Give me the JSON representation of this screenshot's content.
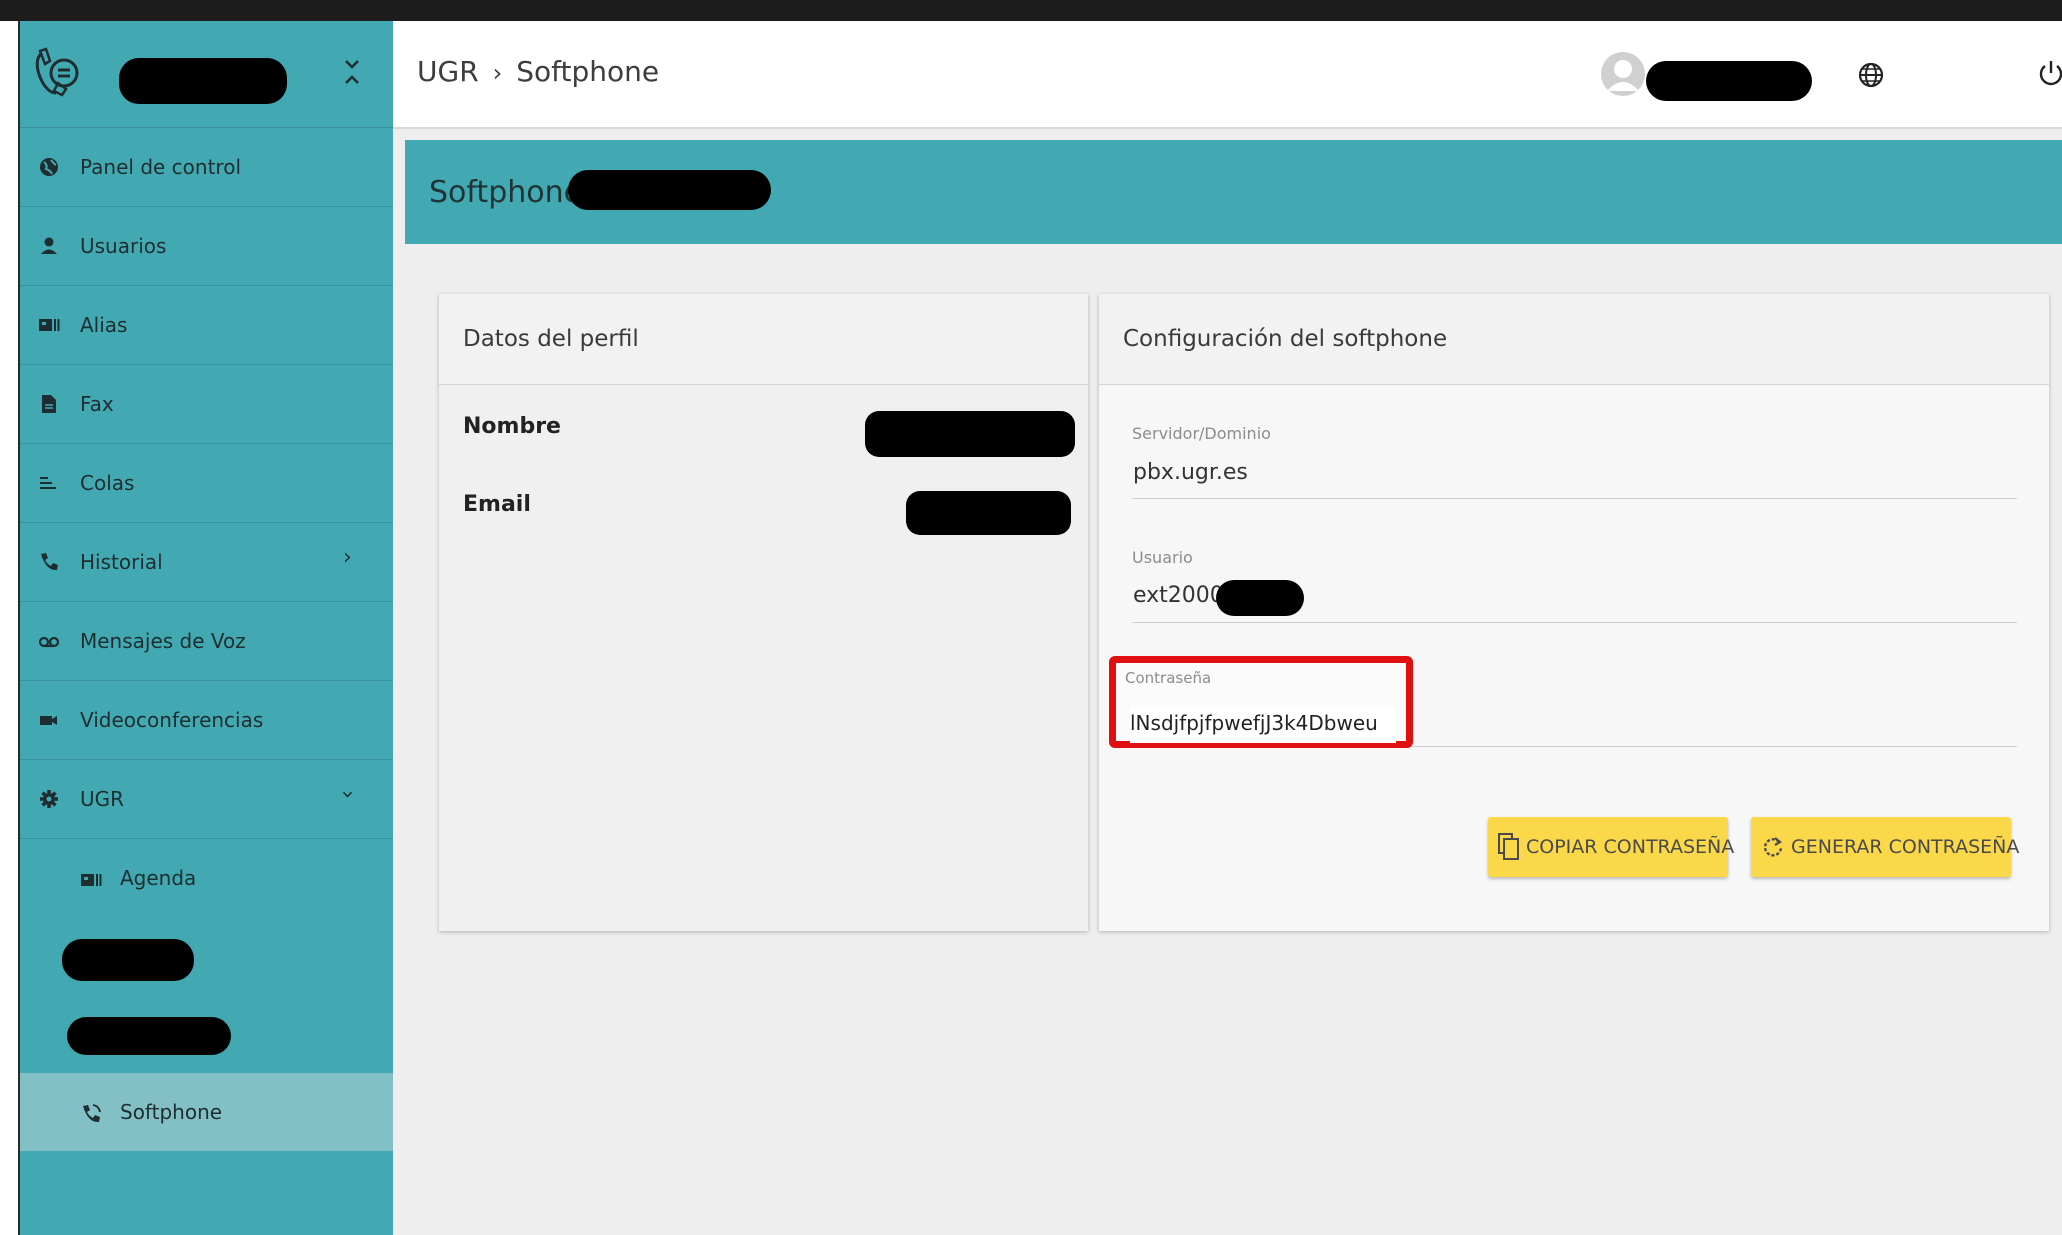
{
  "header": {
    "breadcrumb": [
      "UGR",
      "Softphone"
    ],
    "breadcrumb_separator": "›"
  },
  "sidebar": {
    "items": [
      {
        "label": "Panel de control",
        "icon": "globe-icon"
      },
      {
        "label": "Usuarios",
        "icon": "user-icon"
      },
      {
        "label": "Alias",
        "icon": "contact-card-icon"
      },
      {
        "label": "Fax",
        "icon": "document-icon"
      },
      {
        "label": "Colas",
        "icon": "queue-icon"
      },
      {
        "label": "Historial",
        "icon": "phone-icon"
      },
      {
        "label": "Mensajes de Voz",
        "icon": "voicemail-icon"
      },
      {
        "label": "Videoconferencias",
        "icon": "video-icon"
      },
      {
        "label": "UGR",
        "icon": "gear-icon"
      }
    ],
    "subitems": [
      {
        "label": "Agenda",
        "icon": "contact-card-icon"
      },
      {
        "label": "Softphone",
        "icon": "phone-ringing-icon",
        "active": true
      }
    ]
  },
  "banner": {
    "title": "Softphone -"
  },
  "profile_card": {
    "title": "Datos del perfil",
    "name_label": "Nombre",
    "email_label": "Email"
  },
  "softphone_card": {
    "title": "Configuración del softphone",
    "server_label": "Servidor/Dominio",
    "server_value": "pbx.ugr.es",
    "user_label": "Usuario",
    "user_value": "ext2000",
    "password_label": "Contraseña",
    "password_value": "lNsdjfpjfpwefjJ3k4Dbweu",
    "copy_button": "COPIAR CONTRASEÑA",
    "generate_button": "GENERAR CONTRASEÑA"
  },
  "colors": {
    "teal": "#42a9b2",
    "teal_active": "#82c0c5",
    "button_yellow": "#fbd74a",
    "highlight_red": "#e01010"
  }
}
